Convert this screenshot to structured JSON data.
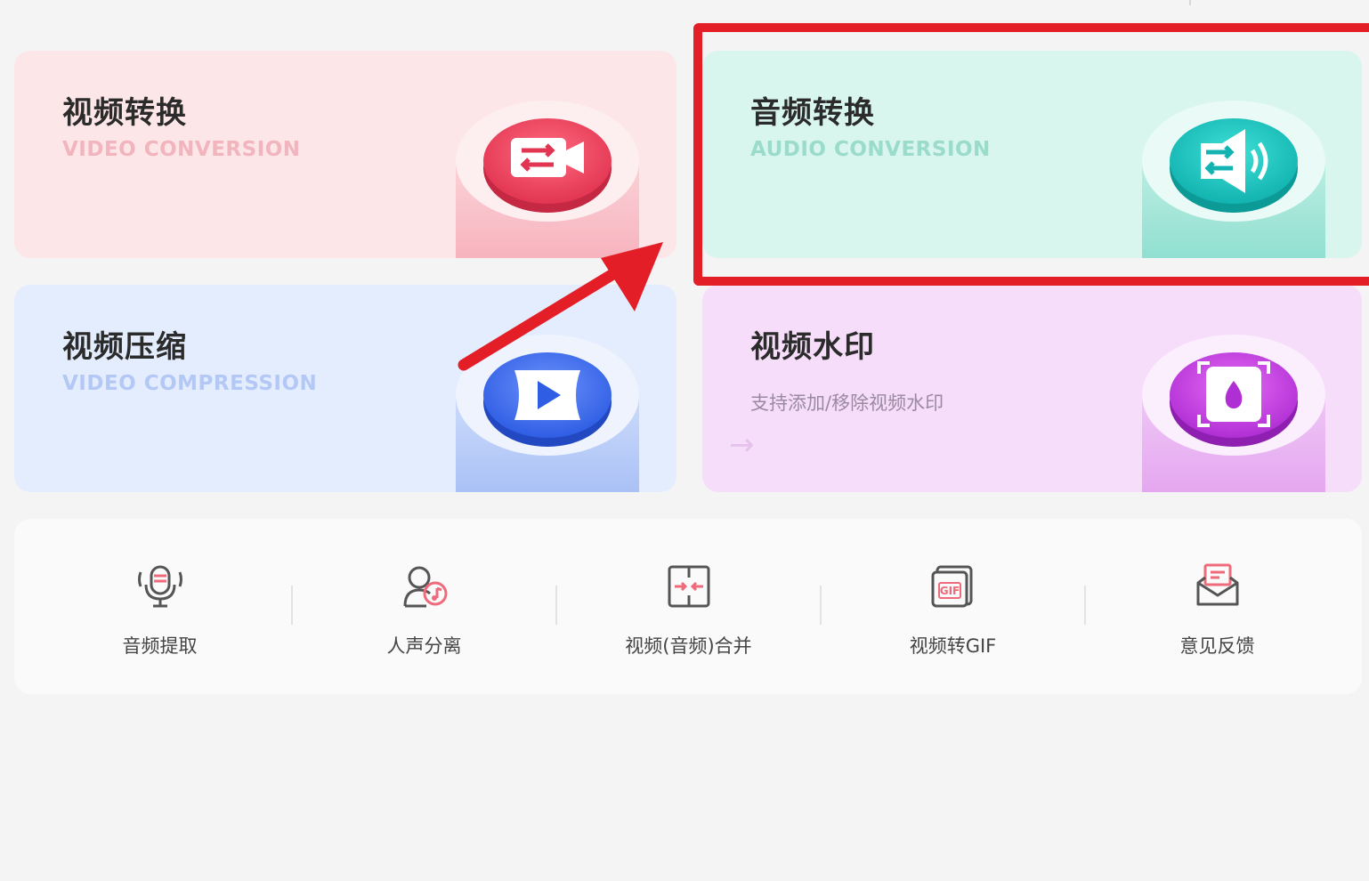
{
  "cards": [
    {
      "title": "视频转换",
      "subtitle": "VIDEO CONVERSION",
      "bg": "#fde6e8",
      "subtitle_color": "#f2b4bd",
      "accent": "#f04a66"
    },
    {
      "title": "音频转换",
      "subtitle": "AUDIO CONVERSION",
      "bg": "#d8f5ee",
      "subtitle_color": "#9adcc9",
      "accent": "#1ec6c0"
    },
    {
      "title": "视频压缩",
      "subtitle": "VIDEO COMPRESSION",
      "bg": "#e4edfe",
      "subtitle_color": "#b4c8f6",
      "accent": "#3d6ff0"
    },
    {
      "title": "视频水印",
      "description": "支持添加/移除视频水印",
      "arrow": "→",
      "bg": "#f6ddf9",
      "accent": "#c23fe0"
    }
  ],
  "tools": [
    {
      "label": "音频提取",
      "icon": "microphone-icon"
    },
    {
      "label": "人声分离",
      "icon": "voice-separation-icon"
    },
    {
      "label": "视频(音频)合并",
      "icon": "merge-icon"
    },
    {
      "label": "视频转GIF",
      "icon": "gif-icon"
    },
    {
      "label": "意见反馈",
      "icon": "feedback-envelope-icon"
    }
  ],
  "annotation": {
    "highlight_color": "#e41e26"
  }
}
